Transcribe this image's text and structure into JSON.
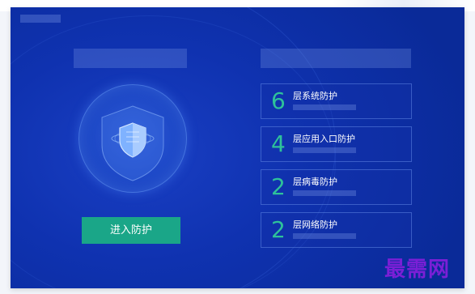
{
  "hero": {
    "enter_button_label": "进入防护"
  },
  "protection_layers": [
    {
      "count": "6",
      "label": "层系统防护"
    },
    {
      "count": "4",
      "label": "层应用入口防护"
    },
    {
      "count": "2",
      "label": "层病毒防护"
    },
    {
      "count": "2",
      "label": "层网络防护"
    }
  ],
  "watermark": {
    "text": "最需网"
  },
  "colors": {
    "background": "#0f32b0",
    "accent_green": "#1aa688",
    "number_green": "#2ec29a",
    "watermark_purple": "#7b1fd6"
  },
  "icons": {
    "shield": "shield-icon"
  }
}
